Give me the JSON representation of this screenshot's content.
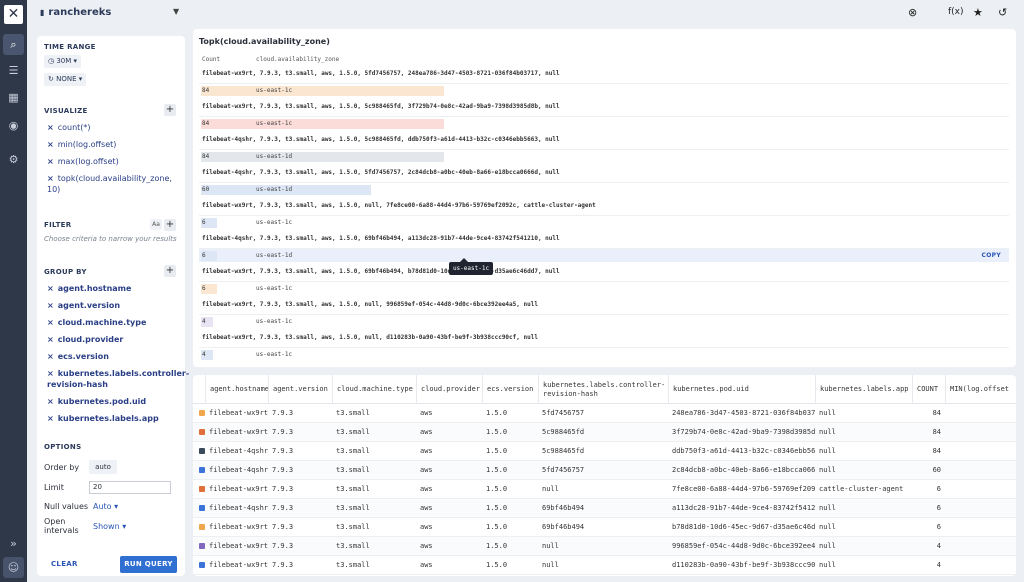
{
  "header": {
    "dataset": "ranchereks",
    "actions": [
      "clear-icon",
      "formula-icon",
      "star-icon",
      "history-icon"
    ],
    "formula_label": "f(x)"
  },
  "rail": {
    "items": [
      "search-icon",
      "list-icon",
      "table-icon",
      "bell-icon",
      "gear-icon"
    ],
    "expand_label": "»"
  },
  "panel": {
    "time_range": {
      "title": "TIME RANGE",
      "range": "30M",
      "compare": "NONE"
    },
    "visualize": {
      "title": "VISUALIZE",
      "items": [
        "count(*)",
        "min(log.offset)",
        "max(log.offset)",
        "topk(cloud.availability_zone, 10)"
      ]
    },
    "filter": {
      "title": "FILTER",
      "hint": "Choose criteria to narrow your results",
      "case_label": "Aa"
    },
    "group_by": {
      "title": "GROUP BY",
      "items": [
        "agent.hostname",
        "agent.version",
        "cloud.machine.type",
        "cloud.provider",
        "ecs.version",
        "kubernetes.labels.controller-revision-hash",
        "kubernetes.pod.uid",
        "kubernetes.labels.app"
      ]
    },
    "options": {
      "title": "OPTIONS",
      "order_by_label": "Order by",
      "order_by_value": "auto",
      "limit_label": "Limit",
      "limit_value": "20",
      "null_label": "Null values",
      "null_value": "Auto",
      "open_label_1": "Open",
      "open_label_2": "intervals",
      "open_value": "Shown"
    },
    "clear_label": "CLEAR",
    "run_label": "RUN QUERY"
  },
  "topk": {
    "title": "Topk(cloud.availability_zone)",
    "col_count": "Count",
    "col_value": "cloud.availability_zone",
    "copy_label": "COPY",
    "tooltip": "us-east-1c",
    "groups": [
      {
        "label": "filebeat-wx9rt, 7.9.3, t3.small, aws, 1.5.0, 5fd7456757, 248ea786-3d47-4503-8721-036f84b03717, null",
        "count": "84",
        "zone": "us-east-1c",
        "color": "#fbe6d2",
        "fill": 0.3
      },
      {
        "label": "filebeat-wx9rt, 7.9.3, t3.small, aws, 1.5.0, 5c988465fd, 3f729b74-0e8c-42ad-9ba9-7398d3985d8b, null",
        "count": "84",
        "zone": "us-east-1c",
        "color": "#fbdcd8",
        "fill": 0.3
      },
      {
        "label": "filebeat-4qshr, 7.9.3, t3.small, aws, 1.5.0, 5c988465fd, ddb750f3-a61d-4413-b32c-c0346ebb5663, null",
        "count": "84",
        "zone": "us-east-1d",
        "color": "#e3e6ea",
        "fill": 0.3
      },
      {
        "label": "filebeat-4qshr, 7.9.3, t3.small, aws, 1.5.0, 5fd7456757, 2c84dcb8-a0bc-40eb-8a66-e18bcca0666d, null",
        "count": "60",
        "zone": "us-east-1d",
        "color": "#dce6f5",
        "fill": 0.21
      },
      {
        "label": "filebeat-wx9rt, 7.9.3, t3.small, aws, 1.5.0, null, 7fe8ce00-6a88-44d4-97b6-59769ef2092c, cattle-cluster-agent",
        "count": "6",
        "zone": "us-east-1c",
        "color": "#dce6f5",
        "fill": 0.02
      },
      {
        "label": "filebeat-4qshr, 7.9.3, t3.small, aws, 1.5.0, 69bf46b494, a113dc28-91b7-44de-9ce4-83742f541210, null",
        "count": "6",
        "zone": "us-east-1d",
        "color": "#dce6f5",
        "fill": 0.02
      },
      {
        "label": "filebeat-wx9rt, 7.9.3, t3.small, aws, 1.5.0, 69bf46b494, b78d81d0-10d6-45ec-9d67-d35ae6c46dd7, null",
        "count": "6",
        "zone": "us-east-1c",
        "color": "#fbe6d2",
        "fill": 0.02
      },
      {
        "label": "filebeat-wx9rt, 7.9.3, t3.small, aws, 1.5.0, null, 996859ef-054c-44d8-9d0c-6bce392ee4a5, null",
        "count": "4",
        "zone": "us-east-1c",
        "color": "#e9e4f3",
        "fill": 0.015
      },
      {
        "label": "filebeat-wx9rt, 7.9.3, t3.small, aws, 1.5.0, null, d110283b-0a90-43bf-be9f-3b938ccc90cf, null",
        "count": "4",
        "zone": "us-east-1c",
        "color": "#dce6f5",
        "fill": 0.015
      }
    ]
  },
  "results": {
    "columns": [
      "agent.hostname",
      "agent.version",
      "cloud.machine.type",
      "cloud.provider",
      "ecs.version",
      "kubernetes.labels.controller-revision-hash",
      "kubernetes.pod.uid",
      "kubernetes.labels.app",
      "COUNT",
      "MIN(log.offset"
    ],
    "rows": [
      {
        "color": "#f0a64a",
        "cells": [
          "filebeat-wx9rt",
          "7.9.3",
          "t3.small",
          "aws",
          "1.5.0",
          "5fd7456757",
          "248ea786-3d47-4503-8721-036f84b03717",
          "null",
          "84",
          ""
        ]
      },
      {
        "color": "#e0703a",
        "cells": [
          "filebeat-wx9rt",
          "7.9.3",
          "t3.small",
          "aws",
          "1.5.0",
          "5c988465fd",
          "3f729b74-0e8c-42ad-9ba9-7398d3985d8b",
          "null",
          "84",
          ""
        ]
      },
      {
        "color": "#3b4a5c",
        "cells": [
          "filebeat-4qshr",
          "7.9.3",
          "t3.small",
          "aws",
          "1.5.0",
          "5c988465fd",
          "ddb750f3-a61d-4413-b32c-c0346ebb5663",
          "null",
          "84",
          ""
        ]
      },
      {
        "color": "#3b73d9",
        "cells": [
          "filebeat-4qshr",
          "7.9.3",
          "t3.small",
          "aws",
          "1.5.0",
          "5fd7456757",
          "2c84dcb8-a0bc-40eb-8a66-e18bcca0666d",
          "null",
          "60",
          ""
        ]
      },
      {
        "color": "#e0703a",
        "cells": [
          "filebeat-wx9rt",
          "7.9.3",
          "t3.small",
          "aws",
          "1.5.0",
          "null",
          "7fe8ce00-6a88-44d4-97b6-59769ef2092c",
          "cattle-cluster-agent",
          "6",
          ""
        ]
      },
      {
        "color": "#3b73d9",
        "cells": [
          "filebeat-4qshr",
          "7.9.3",
          "t3.small",
          "aws",
          "1.5.0",
          "69bf46b494",
          "a113dc28-91b7-44de-9ce4-83742f541210",
          "null",
          "6",
          ""
        ]
      },
      {
        "color": "#f0a64a",
        "cells": [
          "filebeat-wx9rt",
          "7.9.3",
          "t3.small",
          "aws",
          "1.5.0",
          "69bf46b494",
          "b78d81d0-10d6-45ec-9d67-d35ae6c46dd7",
          "null",
          "6",
          ""
        ]
      },
      {
        "color": "#8068c0",
        "cells": [
          "filebeat-wx9rt",
          "7.9.3",
          "t3.small",
          "aws",
          "1.5.0",
          "null",
          "996859ef-054c-44d8-9d0c-6bce392ee4a5",
          "null",
          "4",
          ""
        ]
      },
      {
        "color": "#3b73d9",
        "cells": [
          "filebeat-wx9rt",
          "7.9.3",
          "t3.small",
          "aws",
          "1.5.0",
          "null",
          "d110283b-0a90-43bf-be9f-3b938ccc90cf",
          "null",
          "4",
          ""
        ]
      }
    ]
  }
}
